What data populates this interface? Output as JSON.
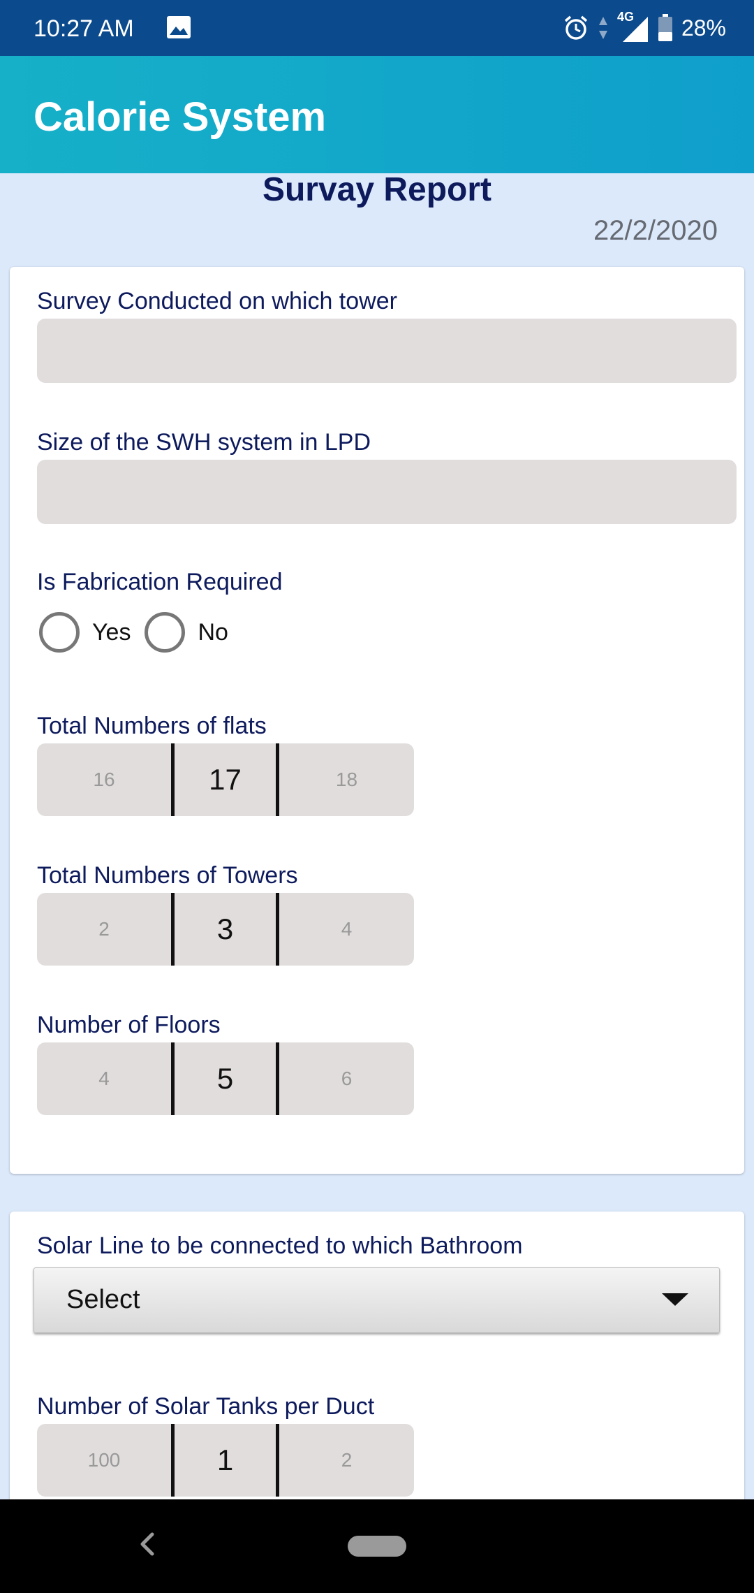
{
  "status_bar": {
    "time": "10:27 AM",
    "network": "4G",
    "battery": "28%",
    "icons": [
      "image-icon",
      "alarm-icon",
      "data-arrows-icon",
      "signal-icon",
      "battery-icon"
    ]
  },
  "app_bar": {
    "title": "Calorie System"
  },
  "report": {
    "title": "Survay Report",
    "date": "22/2/2020"
  },
  "form": {
    "tower_label": "Survey Conducted on which tower",
    "tower_value": "",
    "swh_size_label": "Size of the SWH system in LPD",
    "swh_size_value": "",
    "fabrication": {
      "label": "Is Fabrication Required",
      "options": [
        "Yes",
        "No"
      ],
      "selected": null
    },
    "flats": {
      "label": "Total Numbers of flats",
      "prev": "16",
      "current": "17",
      "next": "18"
    },
    "towers": {
      "label": "Total Numbers of Towers",
      "prev": "2",
      "current": "3",
      "next": "4"
    },
    "floors": {
      "label": "Number of Floors",
      "prev": "4",
      "current": "5",
      "next": "6"
    },
    "bathroom": {
      "label": "Solar Line to be connected to which Bathroom",
      "selected": "Select"
    },
    "tanks": {
      "label": "Number of Solar Tanks per Duct",
      "prev": "100",
      "current": "1",
      "next": "2"
    }
  },
  "colors": {
    "status_bar": "#0b4a8c",
    "app_bar": "#16b0c8",
    "background": "#dce9fb",
    "label_text": "#0d1a5c",
    "input_fill": "#e2dddd"
  }
}
